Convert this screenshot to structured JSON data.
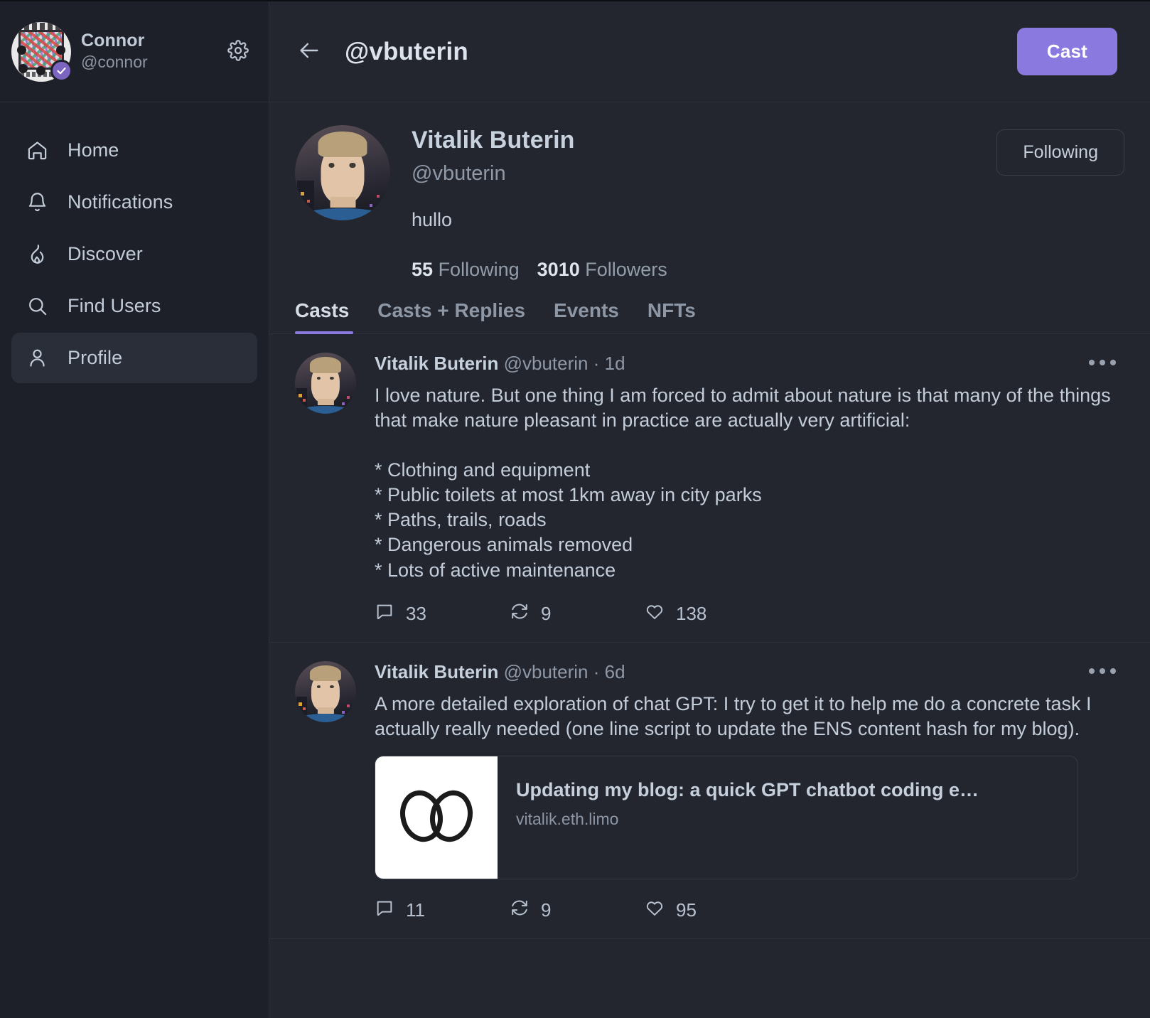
{
  "sidebar": {
    "user": {
      "name": "Connor",
      "handle": "@connor",
      "verified": true
    },
    "settings_icon": "gear-icon",
    "items": [
      {
        "label": "Home",
        "icon": "home-icon",
        "active": false
      },
      {
        "label": "Notifications",
        "icon": "bell-icon",
        "active": false
      },
      {
        "label": "Discover",
        "icon": "flame-icon",
        "active": false
      },
      {
        "label": "Find Users",
        "icon": "search-icon",
        "active": false
      },
      {
        "label": "Profile",
        "icon": "person-icon",
        "active": true
      }
    ]
  },
  "topbar": {
    "back_icon": "arrow-left-icon",
    "title": "@vbuterin",
    "cast_label": "Cast"
  },
  "profile": {
    "display_name": "Vitalik Buterin",
    "handle": "@vbuterin",
    "bio": "hullo",
    "following_count": "55",
    "following_label": "Following",
    "followers_count": "3010",
    "followers_label": "Followers",
    "follow_button_label": "Following"
  },
  "tabs": [
    {
      "label": "Casts",
      "active": true
    },
    {
      "label": "Casts + Replies",
      "active": false
    },
    {
      "label": "Events",
      "active": false
    },
    {
      "label": "NFTs",
      "active": false
    }
  ],
  "casts": [
    {
      "author": "Vitalik Buterin",
      "handle": "@vbuterin",
      "separator": "·",
      "timestamp": "1d",
      "text": "I love nature. But one thing I am forced to admit about nature is that many of the things that make nature pleasant in practice are actually very artificial:\n\n* Clothing and equipment\n* Public toilets at most 1km away in city parks\n* Paths, trails, roads\n* Dangerous animals removed\n* Lots of active maintenance",
      "replies": "33",
      "recasts": "9",
      "likes": "138",
      "more_icon": "ellipsis-icon"
    },
    {
      "author": "Vitalik Buterin",
      "handle": "@vbuterin",
      "separator": "·",
      "timestamp": "6d",
      "text": "A more detailed exploration of chat GPT: I try to get it to help me do a concrete task I actually really needed (one line script to update the ENS content hash for my blog).",
      "link": {
        "title": "Updating my blog: a quick GPT chatbot coding e…",
        "domain": "vitalik.eth.limo",
        "thumb_icon": "infinity-icon"
      },
      "replies": "11",
      "recasts": "9",
      "likes": "95",
      "more_icon": "ellipsis-icon"
    }
  ],
  "action_icons": {
    "reply": "comment-icon",
    "recast": "recast-icon",
    "like": "heart-icon"
  },
  "colors": {
    "accent": "#8a7ae0",
    "background": "#23262f",
    "sidebar_background": "#1e2029",
    "border": "#2c303b",
    "text_primary": "#c3ccd9",
    "text_muted": "#8f98a7"
  }
}
